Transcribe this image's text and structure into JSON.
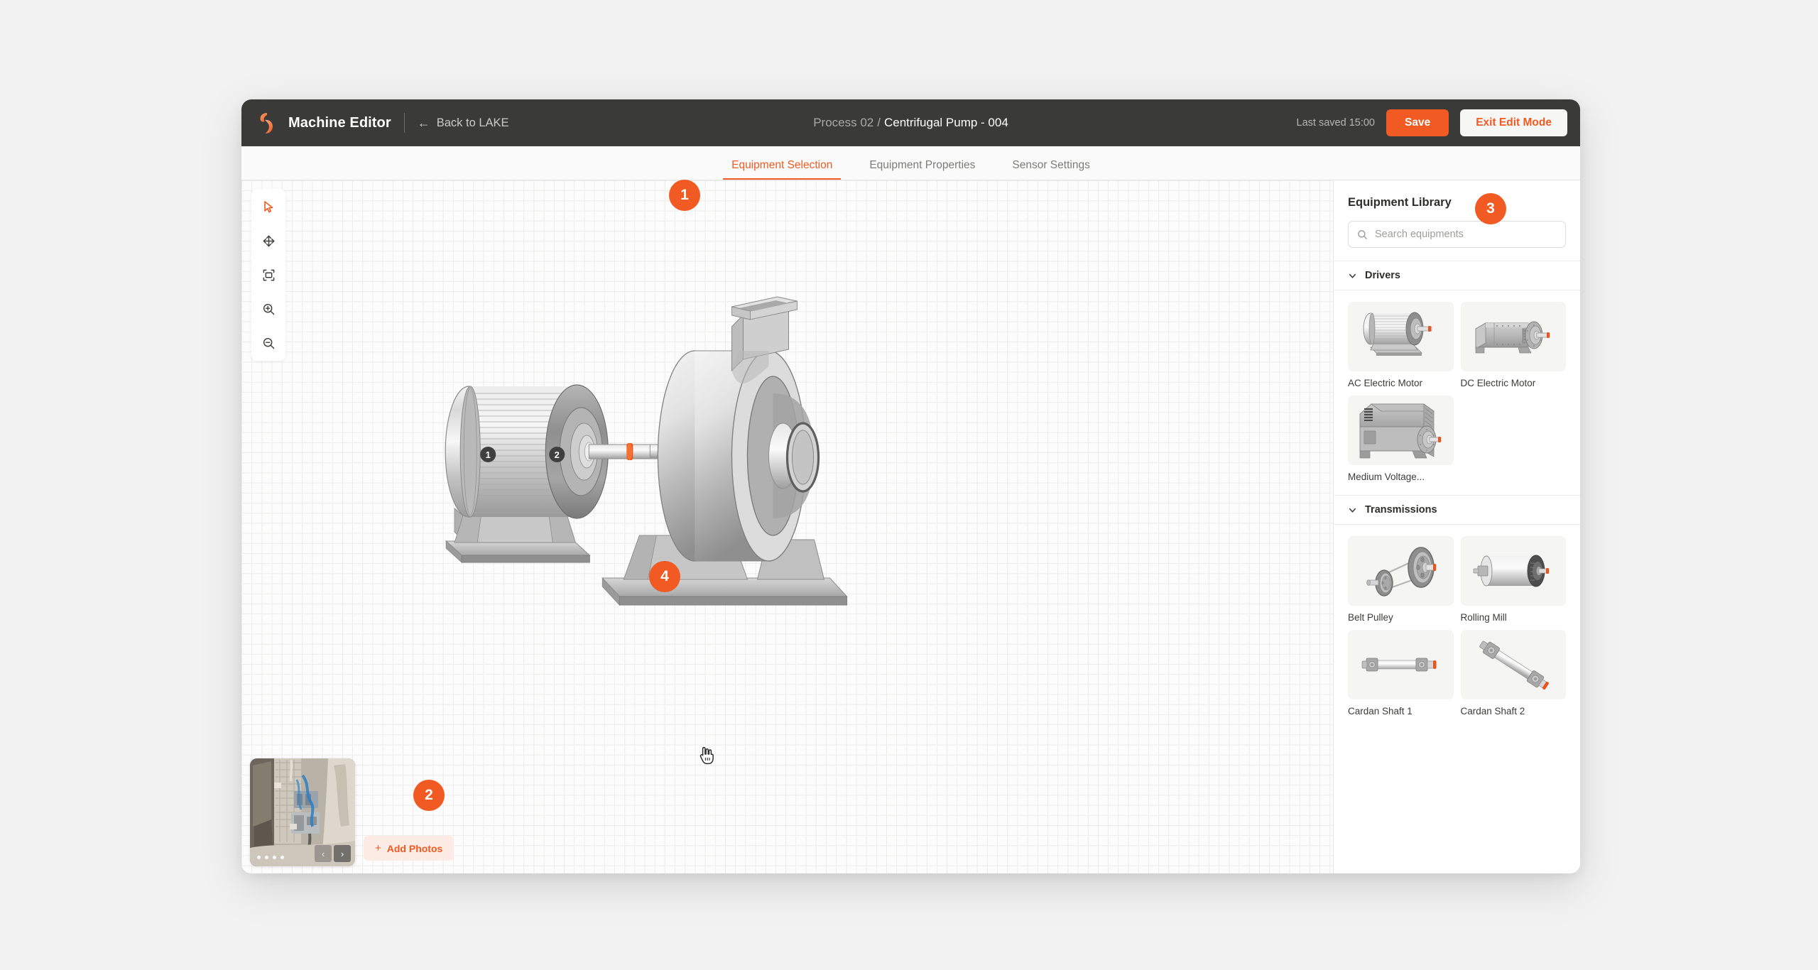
{
  "topbar": {
    "logo_icon": "flame-logo-icon",
    "app_title": "Machine Editor",
    "back_icon": "arrow-left-icon",
    "back_label": "Back to LAKE",
    "breadcrumb_parent": "Process 02",
    "breadcrumb_sep": "/",
    "breadcrumb_current": "Centrifugal Pump - 004",
    "last_saved": "Last saved 15:00",
    "save_label": "Save",
    "exit_label": "Exit Edit Mode"
  },
  "tabs": [
    {
      "label": "Equipment Selection",
      "active": true
    },
    {
      "label": "Equipment Properties",
      "active": false
    },
    {
      "label": "Sensor Settings",
      "active": false
    }
  ],
  "toolbar": [
    {
      "icon": "cursor-select-icon",
      "active": true
    },
    {
      "icon": "move-pan-icon",
      "active": false
    },
    {
      "icon": "fit-to-screen-icon",
      "active": false
    },
    {
      "icon": "zoom-in-icon",
      "active": false
    },
    {
      "icon": "zoom-out-icon",
      "active": false
    }
  ],
  "canvas": {
    "machine_markers": [
      "1",
      "2"
    ],
    "cursor_icon": "pointing-hand-cursor",
    "equipment_on_canvas": [
      "AC Electric Motor",
      "Centrifugal Pump Housing"
    ]
  },
  "photos": {
    "thumb_alt": "machine-site-photo",
    "dot_count": 4,
    "active_dot": 0,
    "prev_icon": "chevron-left-icon",
    "next_icon": "chevron-right-icon",
    "add_photos_label": "Add Photos",
    "add_photos_icon": "plus-icon"
  },
  "library": {
    "title": "Equipment Library",
    "search_placeholder": "Search equipments",
    "search_value": "",
    "search_icon": "search-icon",
    "sections": [
      {
        "name": "Drivers",
        "expanded": true,
        "caret_icon": "chevron-down-icon",
        "items": [
          {
            "label": "AC Electric Motor",
            "icon": "ac-electric-motor-thumb"
          },
          {
            "label": "DC Electric Motor",
            "icon": "dc-electric-motor-thumb"
          },
          {
            "label": "Medium Voltage...",
            "icon": "medium-voltage-motor-thumb"
          }
        ]
      },
      {
        "name": "Transmissions",
        "expanded": true,
        "caret_icon": "chevron-down-icon",
        "items": [
          {
            "label": "Belt Pulley",
            "icon": "belt-pulley-thumb"
          },
          {
            "label": "Rolling Mill",
            "icon": "rolling-mill-thumb"
          },
          {
            "label": "Cardan Shaft 1",
            "icon": "cardan-shaft-1-thumb"
          },
          {
            "label": "Cardan Shaft 2",
            "icon": "cardan-shaft-2-thumb"
          }
        ]
      }
    ]
  },
  "badges": [
    {
      "number": "1",
      "target": "equipment-selection-tab"
    },
    {
      "number": "2",
      "target": "photo-strip"
    },
    {
      "number": "3",
      "target": "equipment-library"
    },
    {
      "number": "4",
      "target": "canvas-motor"
    }
  ],
  "colors": {
    "accent": "#f15a22",
    "topbar_bg": "#3a3a39",
    "canvas_bg": "#fcfcfc",
    "grid_line": "#ececea"
  }
}
